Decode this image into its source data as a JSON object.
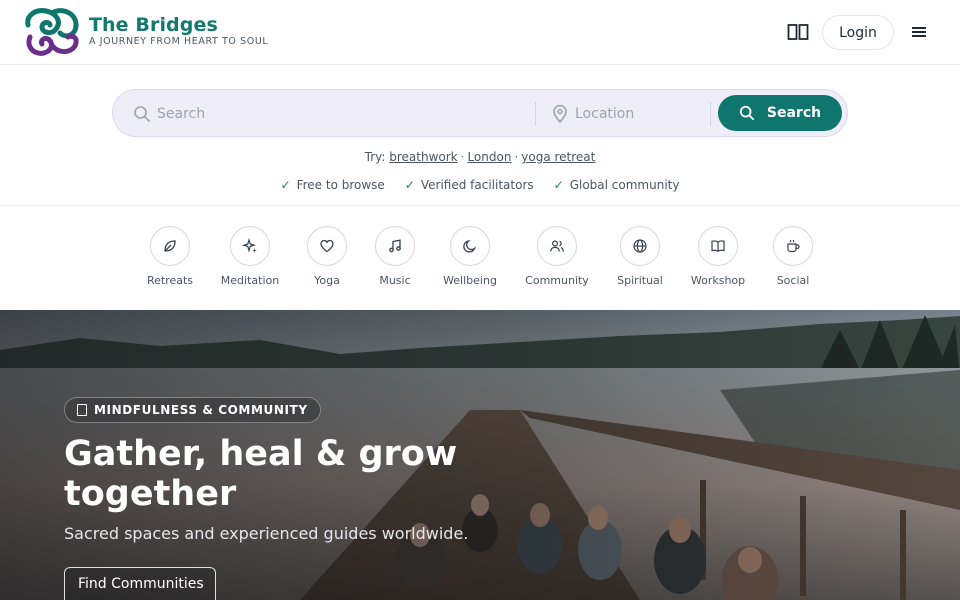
{
  "brand": {
    "name": "The Bridges",
    "tagline": "A JOURNEY FROM HEART TO SOUL",
    "colors": {
      "primary": "#0f766e",
      "logo_purple": "#6b2f8a"
    }
  },
  "header": {
    "book_icon": "open-book-icon",
    "login_label": "Login",
    "menu_icon": "hamburger-menu-icon"
  },
  "search": {
    "query_placeholder": "Search",
    "location_placeholder": "Location",
    "button_label": "Search",
    "try_label": "Try:",
    "suggestions": [
      "breathwork",
      "London",
      "yoga retreat"
    ],
    "separator": "·"
  },
  "trust": [
    {
      "check": "✓",
      "label": "Free to browse"
    },
    {
      "check": "✓",
      "label": "Verified facilitators"
    },
    {
      "check": "✓",
      "label": "Global community"
    }
  ],
  "categories": [
    {
      "label": "Retreats",
      "icon": "leaf-icon"
    },
    {
      "label": "Meditation",
      "icon": "sparkles-icon"
    },
    {
      "label": "Yoga",
      "icon": "heart-icon"
    },
    {
      "label": "Music",
      "icon": "music-note-icon"
    },
    {
      "label": "Wellbeing",
      "icon": "moon-icon"
    },
    {
      "label": "Community",
      "icon": "users-icon"
    },
    {
      "label": "Spiritual",
      "icon": "globe-icon"
    },
    {
      "label": "Workshop",
      "icon": "book-icon"
    },
    {
      "label": "Social",
      "icon": "coffee-cup-icon"
    }
  ],
  "hero": {
    "badge": "MINDFULNESS & COMMUNITY",
    "title": "Gather, heal & grow together",
    "subtitle": "Sacred spaces and experienced guides worldwide.",
    "cta_label": "Find Communities"
  }
}
